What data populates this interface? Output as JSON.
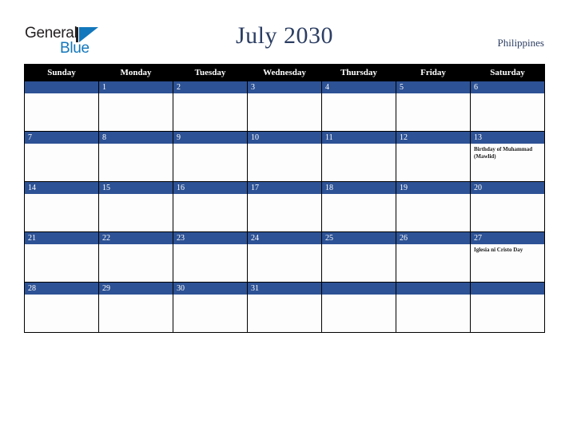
{
  "branding": {
    "logo_text_top": "General",
    "logo_text_bottom": "Blue",
    "logo_accent_color": "#1277bc"
  },
  "header": {
    "title": "July 2030",
    "country": "Philippines",
    "title_color": "#2c3e63"
  },
  "calendar": {
    "month": "July",
    "year": "2030",
    "weekday_headers": [
      "Sunday",
      "Monday",
      "Tuesday",
      "Wednesday",
      "Thursday",
      "Friday",
      "Saturday"
    ],
    "header_bg_color": "#000000",
    "daynum_bg_color": "#2d5295",
    "weeks": [
      [
        {
          "day": "",
          "events": []
        },
        {
          "day": "1",
          "events": []
        },
        {
          "day": "2",
          "events": []
        },
        {
          "day": "3",
          "events": []
        },
        {
          "day": "4",
          "events": []
        },
        {
          "day": "5",
          "events": []
        },
        {
          "day": "6",
          "events": []
        }
      ],
      [
        {
          "day": "7",
          "events": []
        },
        {
          "day": "8",
          "events": []
        },
        {
          "day": "9",
          "events": []
        },
        {
          "day": "10",
          "events": []
        },
        {
          "day": "11",
          "events": []
        },
        {
          "day": "12",
          "events": []
        },
        {
          "day": "13",
          "events": [
            "Birthday of Muhammad (Mawlid)"
          ]
        }
      ],
      [
        {
          "day": "14",
          "events": []
        },
        {
          "day": "15",
          "events": []
        },
        {
          "day": "16",
          "events": []
        },
        {
          "day": "17",
          "events": []
        },
        {
          "day": "18",
          "events": []
        },
        {
          "day": "19",
          "events": []
        },
        {
          "day": "20",
          "events": []
        }
      ],
      [
        {
          "day": "21",
          "events": []
        },
        {
          "day": "22",
          "events": []
        },
        {
          "day": "23",
          "events": []
        },
        {
          "day": "24",
          "events": []
        },
        {
          "day": "25",
          "events": []
        },
        {
          "day": "26",
          "events": []
        },
        {
          "day": "27",
          "events": [
            "Iglesia ni Cristo Day"
          ]
        }
      ],
      [
        {
          "day": "28",
          "events": []
        },
        {
          "day": "29",
          "events": []
        },
        {
          "day": "30",
          "events": []
        },
        {
          "day": "31",
          "events": []
        },
        {
          "day": "",
          "events": []
        },
        {
          "day": "",
          "events": []
        },
        {
          "day": "",
          "events": []
        }
      ]
    ]
  }
}
